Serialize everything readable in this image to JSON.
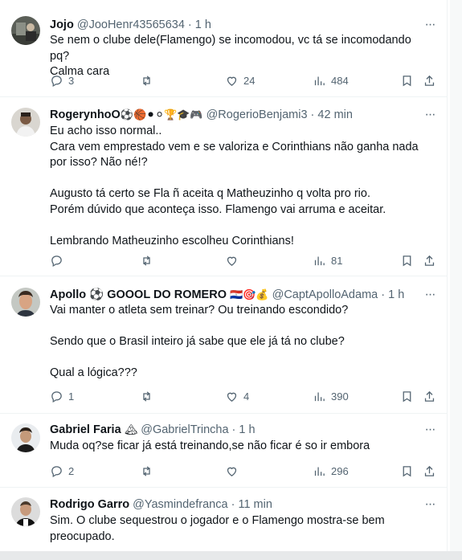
{
  "tweets": [
    {
      "name": "Jojo",
      "emojis": "",
      "handle": "@JooHenr43565634",
      "dot": "·",
      "time": "1 h",
      "more": "···",
      "text": "Se nem o clube dele(Flamengo) se incomodou, vc tá se incomodando pq?\nCalma cara",
      "replies": "3",
      "retweets": "",
      "likes": "24",
      "views": "484"
    },
    {
      "name": "RogerynhoO",
      "emojis": "⚽🏀⚫⚪🏆🎓🎮",
      "handle": "@RogerioBenjami3",
      "dot": "·",
      "time": "42 min",
      "more": "···",
      "text": "Eu acho isso normal..\nCara vem emprestado vem e se valoriza e Corinthians não ganha nada por isso? Não né!?\n\nAugusto tá certo se Fla ñ aceita q Matheuzinho q volta pro rio.\nPorém dúvido que aconteça isso. Flamengo vai arruma e aceitar.\n\nLembrando Matheuzinho escolheu Corinthians!",
      "replies": "",
      "retweets": "",
      "likes": "",
      "views": "81"
    },
    {
      "name": "Apollo ⚽ GOOOL DO ROMERO",
      "emojis": "🇵🇾🎯💰",
      "handle": "@CaptApolloAdama",
      "dot": "·",
      "time": "1 h",
      "more": "···",
      "text": "Vai manter o atleta sem treinar? Ou treinando escondido?\n\nSendo que o Brasil inteiro já sabe que ele já tá no clube?\n\nQual a lógica???",
      "replies": "1",
      "retweets": "",
      "likes": "4",
      "views": "390"
    },
    {
      "name": "Gabriel Faria",
      "emojis": "🏔",
      "handle": "@GabrielTrincha",
      "dot": "·",
      "time": "1 h",
      "more": "···",
      "text": "Muda oq?se ficar já está treinando,se não ficar é so ir embora",
      "replies": "2",
      "retweets": "",
      "likes": "",
      "views": "296"
    },
    {
      "name": "Rodrigo Garro",
      "emojis": "",
      "handle": "@Yasmindefranca",
      "dot": "·",
      "time": "11 min",
      "more": "···",
      "text": "Sim. O clube sequestrou o jogador e o Flamengo mostra-se bem preocupado.",
      "replies": "",
      "retweets": "",
      "likes": "",
      "views": ""
    }
  ],
  "colors": {
    "text": "#0f1419",
    "secondary": "#536471",
    "border": "#eff3f4"
  },
  "icons": [
    "reply-icon",
    "retweet-icon",
    "like-icon",
    "views-icon",
    "bookmark-icon",
    "share-icon",
    "more-icon"
  ]
}
